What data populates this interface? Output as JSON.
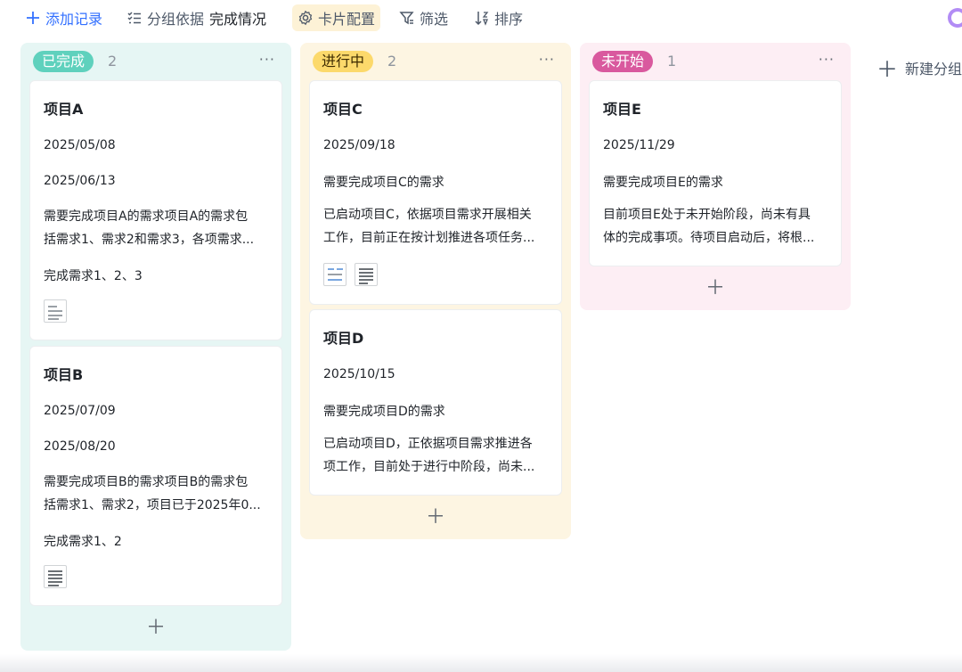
{
  "toolbar": {
    "add_record": "添加记录",
    "group_by_label": "分组依据",
    "group_by_value": "完成情况",
    "card_config": "卡片配置",
    "filter": "筛选",
    "sort": "排序"
  },
  "colors": {
    "accent": "#3370ff",
    "done": "#5fd1bd",
    "in_progress": "#fcd96b",
    "todo": "#d9599e"
  },
  "columns": [
    {
      "tag": "已完成",
      "count": "2",
      "cards": [
        {
          "title": "项目A",
          "start": "2025/05/08",
          "end": "2025/06/13",
          "desc": [
            "需要完成项目A的需求项目A的需求包",
            "括需求1、需求2和需求3，各项需求..."
          ],
          "result": "完成需求1、2、3"
        },
        {
          "title": "项目B",
          "start": "2025/07/09",
          "end": "2025/08/20",
          "desc": [
            "需要完成项目B的需求项目B的需求包",
            "括需求1、需求2，项目已于2025年0..."
          ],
          "result": "完成需求1、2"
        }
      ]
    },
    {
      "tag": "进行中",
      "count": "2",
      "cards": [
        {
          "title": "项目C",
          "start": "2025/09/18",
          "need": "需要完成项目C的需求",
          "desc": [
            "已启动项目C，依据项目需求开展相关",
            "工作，目前正在按计划推进各项任务..."
          ]
        },
        {
          "title": "项目D",
          "start": "2025/10/15",
          "need": "需要完成项目D的需求",
          "desc": [
            "已启动项目D，正依据项目需求推进各",
            "项工作，目前处于进行中阶段，尚未..."
          ]
        }
      ]
    },
    {
      "tag": "未开始",
      "count": "1",
      "cards": [
        {
          "title": "项目E",
          "start": "2025/11/29",
          "need": "需要完成项目E的需求",
          "desc": [
            "目前项目E处于未开始阶段，尚未有具",
            "体的完成事项。待项目启动后，将根..."
          ]
        }
      ]
    }
  ],
  "new_group": "新建分组",
  "icons": [
    "plus-icon",
    "group-icon",
    "gear-icon",
    "filter-icon",
    "sort-icon",
    "more-icon",
    "attachment-thumbnail"
  ]
}
